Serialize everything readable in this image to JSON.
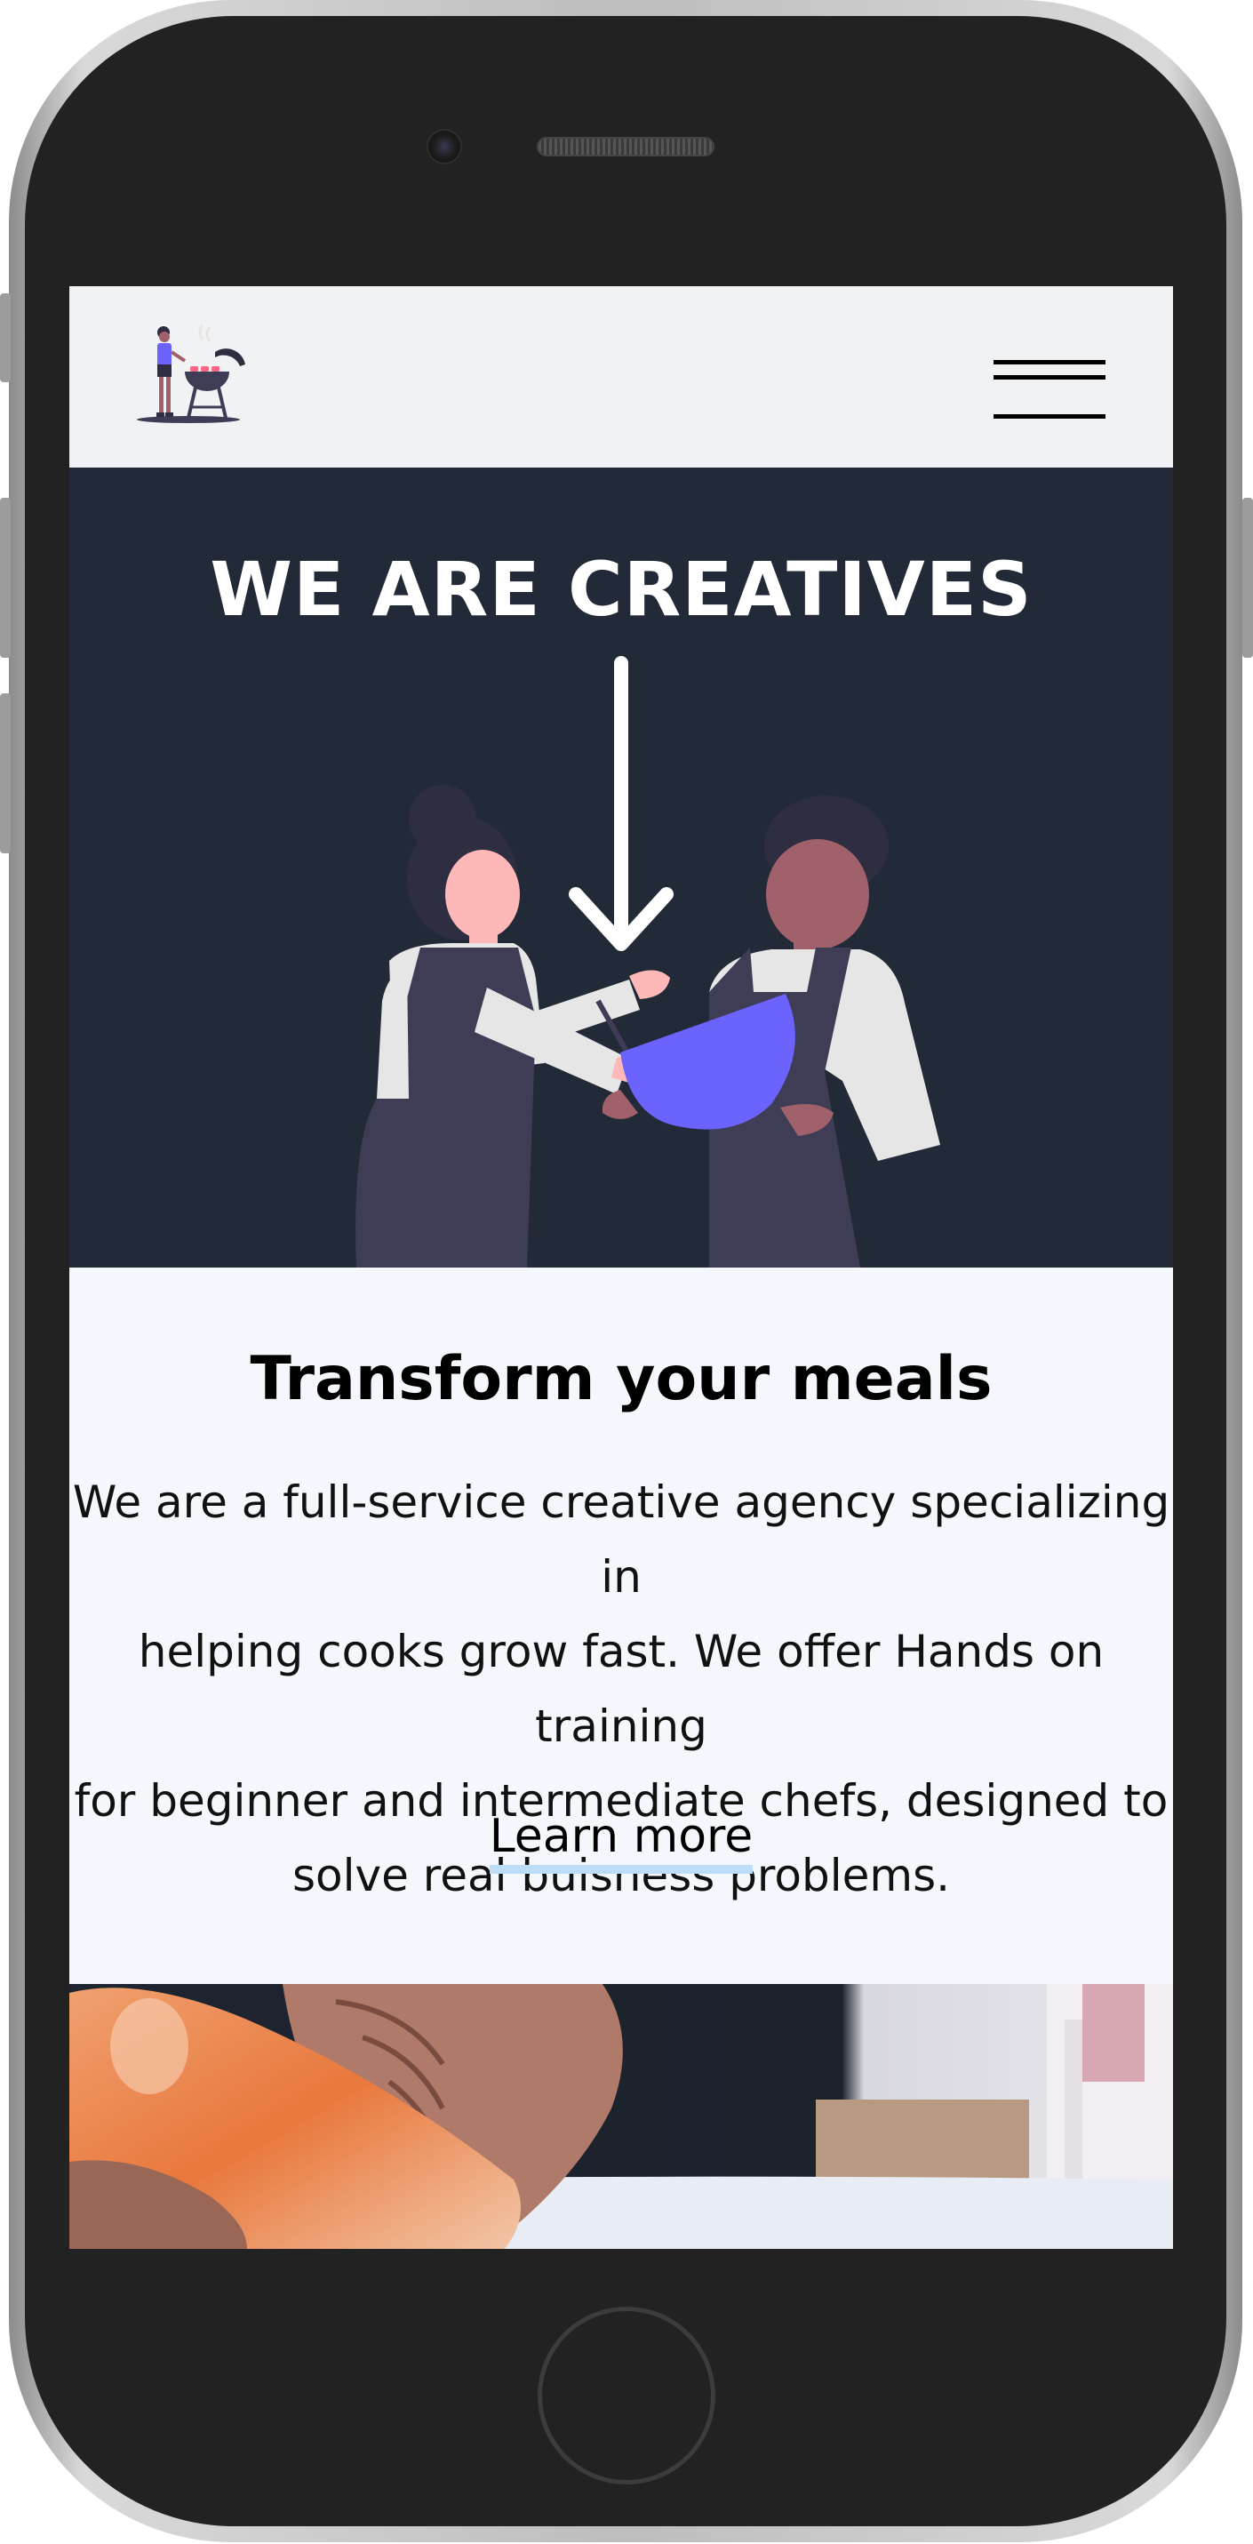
{
  "hero": {
    "title": "WE ARE CREATIVES"
  },
  "content": {
    "title": "Transform your meals",
    "body_line1": "We are a full-service creative agency specializing in",
    "body_line2": "helping cooks grow fast. We offer Hands on training",
    "body_line3": "for beginner and intermediate chefs, designed to",
    "body_line4": "solve real buisness problems.",
    "cta_label": "Learn more"
  },
  "icons": {
    "logo": "grilling-person-logo",
    "menu": "hamburger-menu-icon",
    "arrow": "arrow-down-icon"
  },
  "colors": {
    "hero_bg": "#222a38",
    "navbar_bg": "#f1f2f4",
    "content_bg": "#f4f8fc",
    "accent_purple": "#6c63ff",
    "link_underline": "#bcdcf7"
  }
}
